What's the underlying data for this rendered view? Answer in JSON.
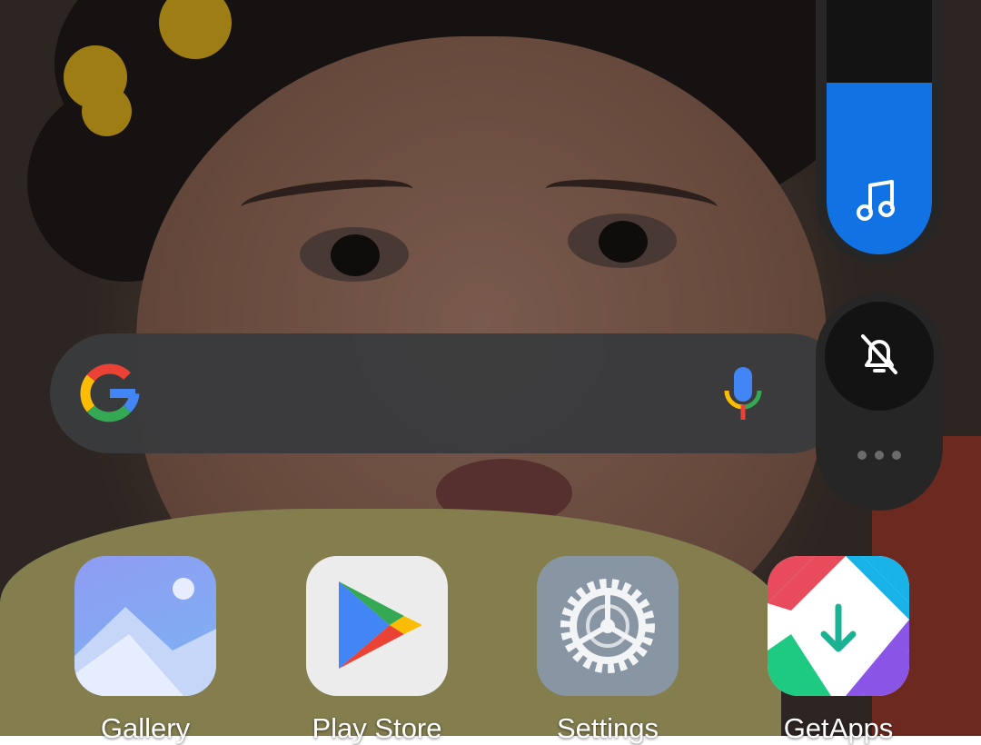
{
  "search_widget": {
    "logo_icon": "google-g-icon",
    "voice_icon": "microphone-icon"
  },
  "volume_panel": {
    "media_volume_level": 0.61,
    "media_icon": "music-note-icon",
    "ringer_icon": "bell-off-icon",
    "more_icon": "more-dots-icon",
    "accent_color": "#1173e3"
  },
  "dock": {
    "apps": [
      {
        "label": "Gallery",
        "icon": "gallery-icon"
      },
      {
        "label": "Play Store",
        "icon": "play-store-icon"
      },
      {
        "label": "Settings",
        "icon": "settings-gear-icon"
      },
      {
        "label": "GetApps",
        "icon": "getapps-icon"
      }
    ]
  }
}
